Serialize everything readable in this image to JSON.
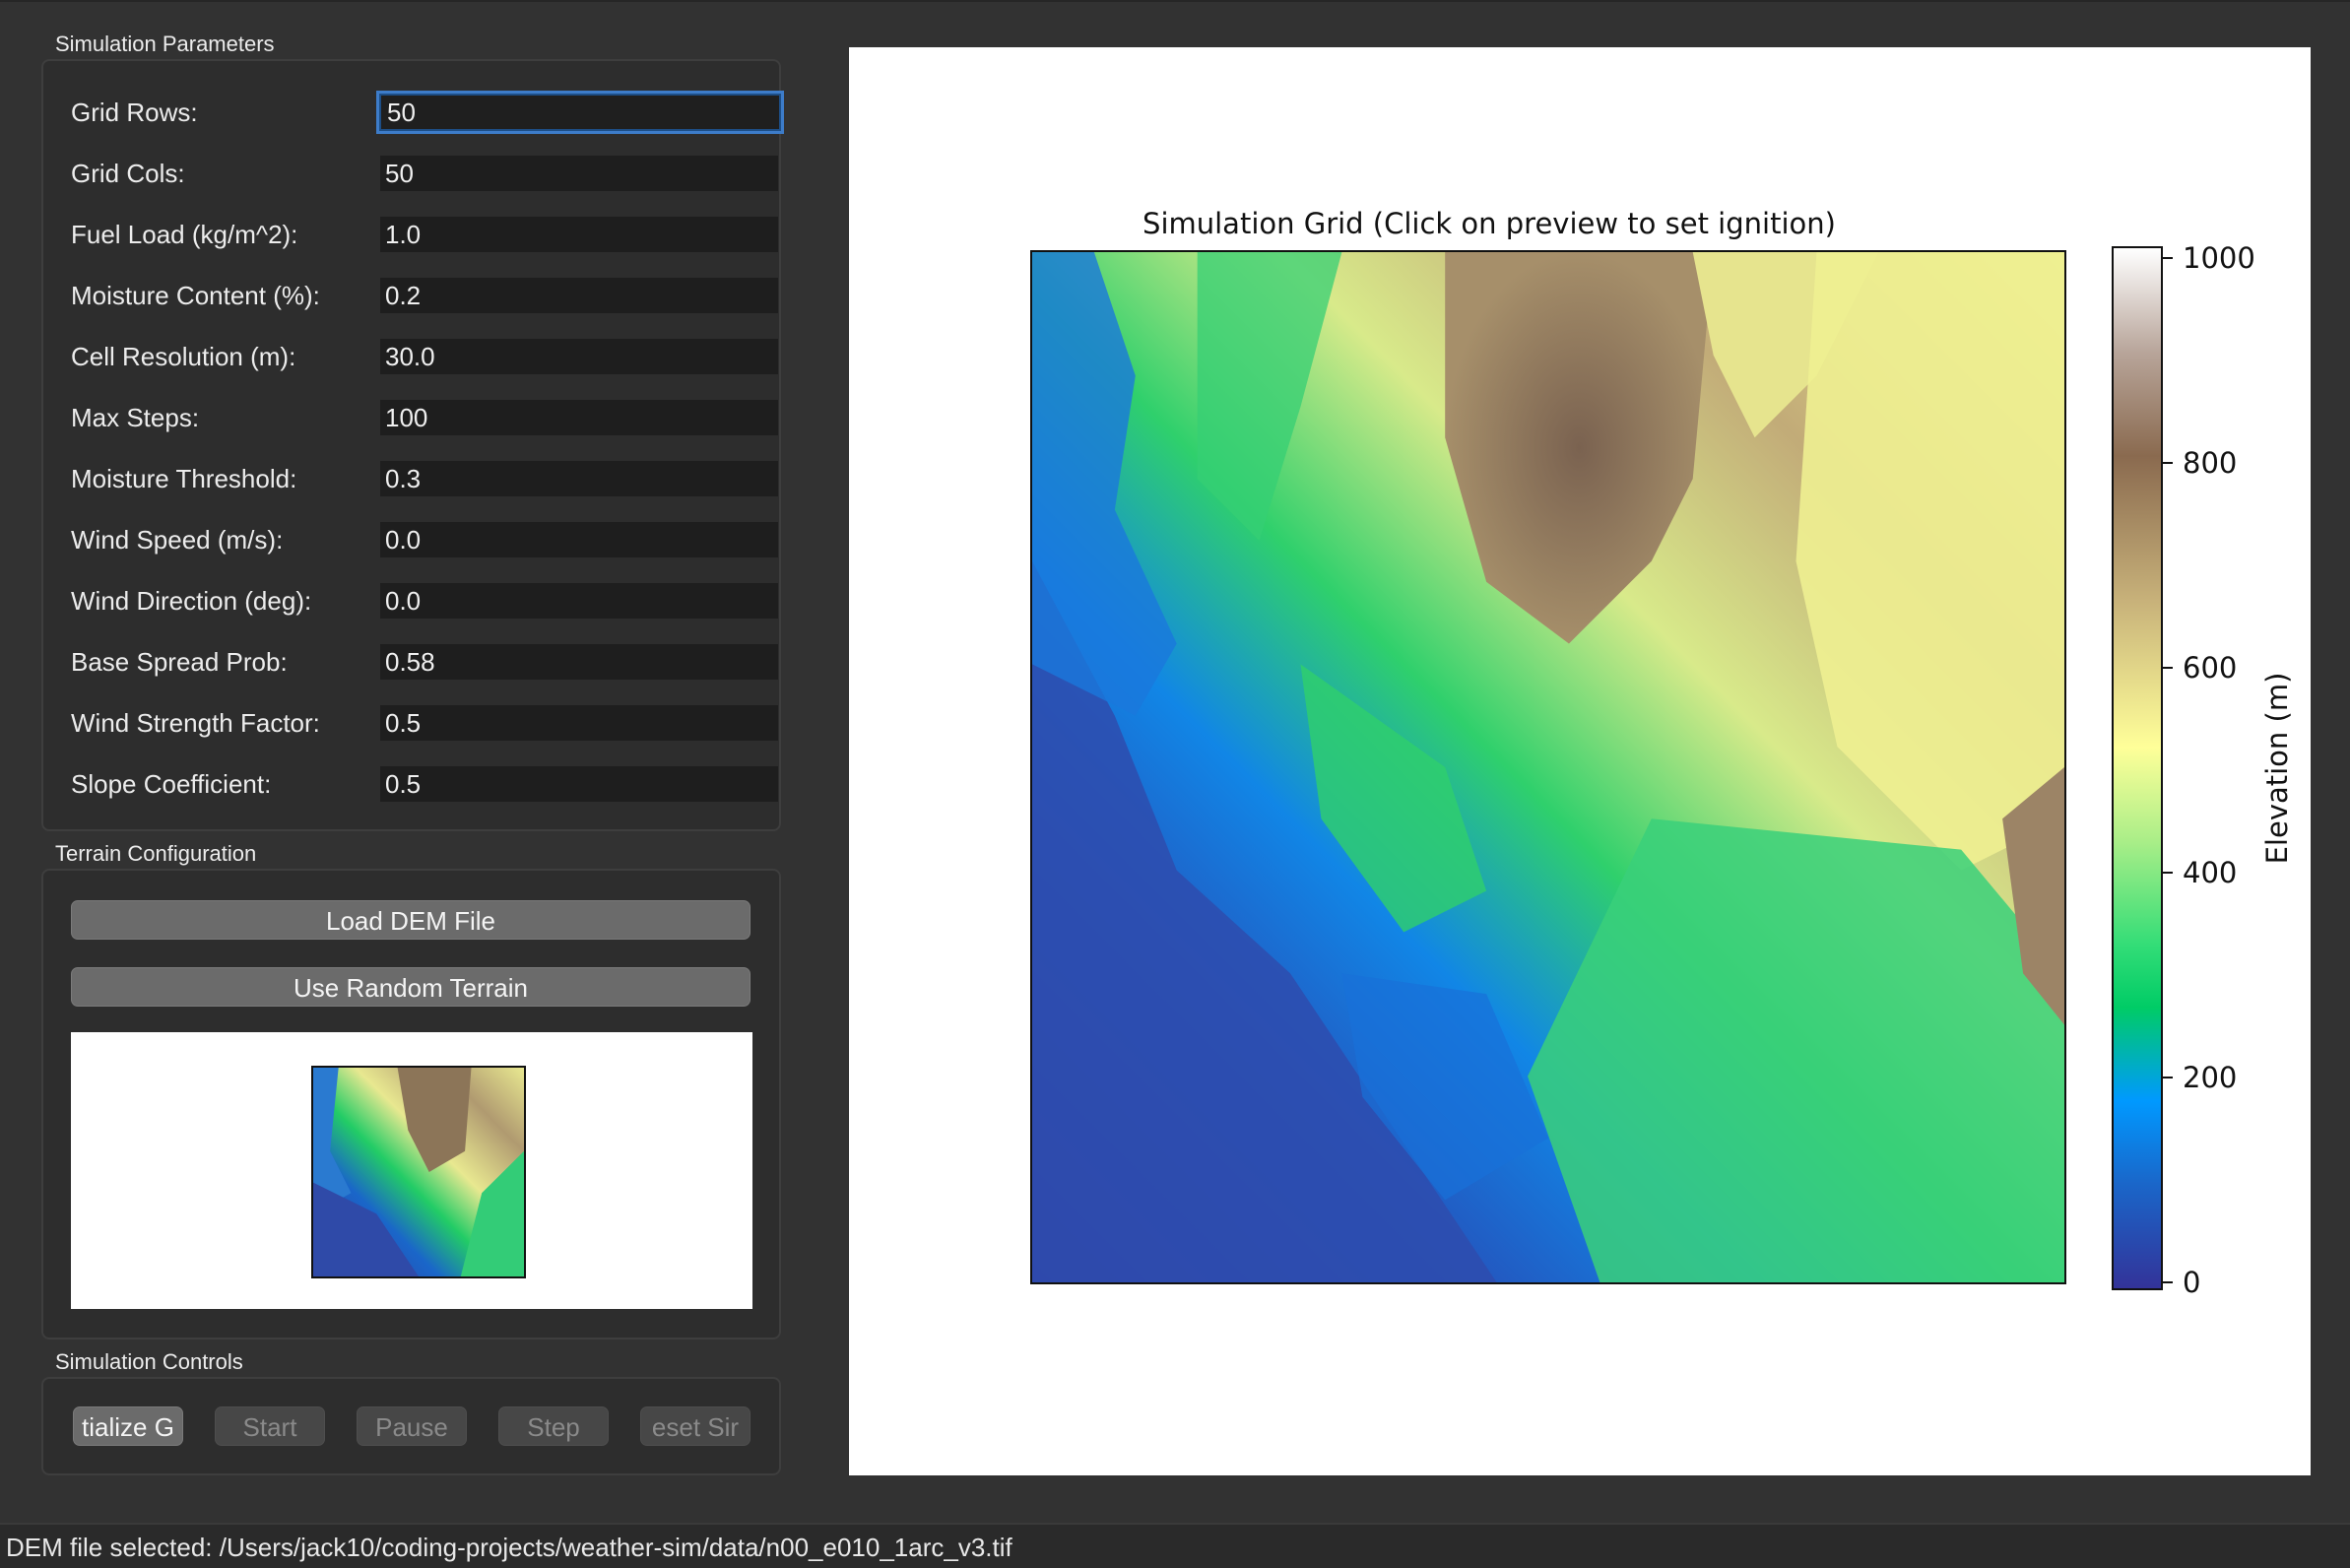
{
  "groups": {
    "params_title": "Simulation Parameters",
    "terrain_title": "Terrain Configuration",
    "controls_title": "Simulation Controls"
  },
  "params": [
    {
      "label": "Grid Rows:",
      "value": "50"
    },
    {
      "label": "Grid Cols:",
      "value": "50"
    },
    {
      "label": "Fuel Load (kg/m^2):",
      "value": "1.0"
    },
    {
      "label": "Moisture Content (%):",
      "value": "0.2"
    },
    {
      "label": "Cell Resolution (m):",
      "value": "30.0"
    },
    {
      "label": "Max Steps:",
      "value": "100"
    },
    {
      "label": "Moisture Threshold:",
      "value": "0.3"
    },
    {
      "label": "Wind Speed (m/s):",
      "value": "0.0"
    },
    {
      "label": "Wind Direction (deg):",
      "value": "0.0"
    },
    {
      "label": "Base Spread Prob:",
      "value": "0.58"
    },
    {
      "label": "Wind Strength Factor:",
      "value": "0.5"
    },
    {
      "label": "Slope Coefficient:",
      "value": "0.5"
    }
  ],
  "terrain": {
    "load_label": "Load DEM File",
    "random_label": "Use Random Terrain"
  },
  "controls": {
    "initialize": "tialize G",
    "start": "Start",
    "pause": "Pause",
    "step": "Step",
    "reset": "eset Sir"
  },
  "plot": {
    "title": "Simulation Grid (Click on preview to set ignition)",
    "colorbar_label": "Elevation (m)",
    "colorbar_ticks": [
      "1000",
      "800",
      "600",
      "400",
      "200",
      "0"
    ]
  },
  "colors": {
    "accent_focus": "#3d7cc9",
    "low_elevation": "#333399",
    "mid_elevation": "#33dd77",
    "high_elevation": "#8a6a4f"
  },
  "status": {
    "text": "DEM file selected: /Users/jack10/coding-projects/weather-sim/data/n00_e010_1arc_v3.tif"
  }
}
